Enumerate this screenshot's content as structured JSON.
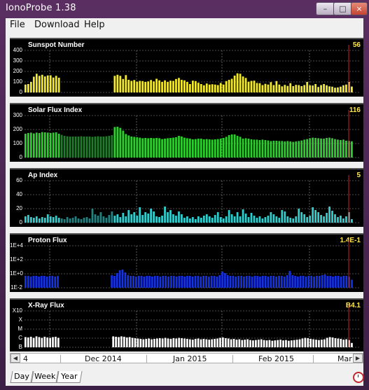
{
  "window": {
    "title": "IonoProbe 1.38"
  },
  "title_buttons": {
    "minimize": "–",
    "maximize": "□",
    "close": "×"
  },
  "menu": {
    "items": [
      "File",
      "Download",
      "Help"
    ]
  },
  "colors": {
    "sunspot": "#f4ea2d",
    "solar_flux": "#2bd12b",
    "ap": "#30cfcf",
    "proton": "#1432e6",
    "xray": "#ffffff",
    "marker": "#cc2222",
    "grid": "#9a9a9a",
    "value_text": "#ffe84a"
  },
  "chart_data": [
    {
      "type": "bar",
      "title": "Sunspot Number",
      "current_value": "56",
      "ylim": [
        0,
        400
      ],
      "yticks": [
        "400",
        "300",
        "200",
        "100",
        "0"
      ],
      "values": [
        75,
        80,
        100,
        150,
        178,
        158,
        168,
        152,
        162,
        163,
        142,
        158,
        140,
        null,
        null,
        null,
        null,
        null,
        null,
        null,
        null,
        null,
        null,
        null,
        null,
        null,
        null,
        null,
        null,
        null,
        null,
        null,
        158,
        168,
        158,
        128,
        165,
        120,
        110,
        118,
        102,
        110,
        108,
        100,
        105,
        118,
        105,
        130,
        115,
        100,
        115,
        100,
        112,
        110,
        128,
        138,
        120,
        115,
        100,
        80,
        112,
        108,
        92,
        80,
        68,
        85,
        75,
        78,
        75,
        70,
        90,
        75,
        108,
        120,
        130,
        160,
        182,
        178,
        152,
        138,
        102,
        110,
        112,
        90,
        88,
        70,
        82,
        75,
        98,
        70,
        108,
        75,
        58,
        72,
        62,
        88,
        60,
        72,
        70,
        60,
        70,
        100,
        68,
        66,
        80,
        52,
        70,
        80,
        68,
        58,
        55,
        45,
        48,
        55,
        68,
        75,
        100,
        56
      ]
    },
    {
      "type": "bar",
      "title": "Solar Flux Index",
      "current_value": "116",
      "ylim": [
        0,
        300
      ],
      "yticks": [
        "300",
        "200",
        "100",
        "0"
      ],
      "values": [
        170,
        175,
        178,
        172,
        178,
        175,
        182,
        180,
        178,
        175,
        178,
        180,
        170,
        162,
        155,
        152,
        150,
        150,
        150,
        150,
        152,
        150,
        150,
        150,
        148,
        150,
        152,
        150,
        150,
        152,
        155,
        160,
        218,
        220,
        212,
        192,
        168,
        158,
        150,
        148,
        145,
        142,
        138,
        140,
        138,
        140,
        138,
        140,
        138,
        132,
        135,
        138,
        140,
        142,
        145,
        155,
        150,
        142,
        138,
        135,
        130,
        132,
        135,
        135,
        130,
        132,
        130,
        128,
        130,
        132,
        135,
        140,
        148,
        160,
        165,
        165,
        155,
        148,
        135,
        138,
        135,
        130,
        128,
        128,
        125,
        128,
        125,
        122,
        118,
        120,
        120,
        118,
        118,
        115,
        118,
        115,
        112,
        115,
        118,
        122,
        128,
        132,
        138,
        142,
        140,
        138,
        136,
        135,
        140,
        142,
        138,
        132,
        128,
        125,
        128,
        120,
        118,
        116
      ],
      "shaded_range": [
        13,
        31
      ]
    },
    {
      "type": "bar",
      "title": "Ap Index",
      "current_value": "5",
      "ylim": [
        0,
        60
      ],
      "yticks": [
        "60",
        "40",
        "20",
        "0"
      ],
      "values": [
        9,
        11,
        8,
        7,
        9,
        6,
        8,
        7,
        12,
        9,
        8,
        10,
        7,
        6,
        5,
        8,
        6,
        7,
        9,
        6,
        5,
        7,
        8,
        6,
        20,
        12,
        10,
        15,
        9,
        7,
        11,
        16,
        10,
        12,
        8,
        14,
        9,
        18,
        12,
        15,
        10,
        22,
        11,
        15,
        13,
        20,
        16,
        9,
        8,
        10,
        23,
        15,
        18,
        12,
        10,
        16,
        12,
        7,
        9,
        6,
        8,
        5,
        9,
        7,
        10,
        12,
        9,
        7,
        11,
        15,
        8,
        6,
        9,
        18,
        12,
        9,
        15,
        9,
        19,
        13,
        8,
        14,
        10,
        7,
        9,
        6,
        8,
        10,
        15,
        12,
        9,
        7,
        18,
        16,
        9,
        7,
        6,
        9,
        20,
        15,
        12,
        8,
        10,
        22,
        18,
        15,
        11,
        9,
        14,
        23,
        17,
        12,
        8,
        10,
        6,
        9,
        15,
        5
      ],
      "shaded_range": [
        13,
        31
      ]
    },
    {
      "type": "bar",
      "title": "Proton Flux",
      "current_value": "1.4E-1",
      "yscale": "log",
      "ylim": [
        -2,
        4
      ],
      "yticks": [
        "1E+4",
        "1E+2",
        "1E+0",
        "1E-2"
      ],
      "values": [
        -0.3,
        -0.3,
        -0.4,
        -0.3,
        -0.3,
        -0.4,
        -0.3,
        -0.3,
        -0.4,
        -0.3,
        -0.3,
        -0.4,
        -0.3,
        null,
        null,
        null,
        null,
        null,
        null,
        null,
        null,
        null,
        null,
        null,
        null,
        null,
        null,
        null,
        null,
        null,
        null,
        null,
        -0.2,
        -0.3,
        0.1,
        0.5,
        0.6,
        0.2,
        -0.2,
        -0.3,
        -0.3,
        -0.4,
        -0.3,
        -0.3,
        -0.4,
        -0.3,
        -0.3,
        -0.4,
        -0.3,
        -0.3,
        -0.4,
        -0.3,
        -0.3,
        -0.4,
        -0.3,
        -0.3,
        -0.4,
        -0.3,
        -0.3,
        -0.4,
        -0.3,
        -0.3,
        -0.4,
        -0.3,
        -0.3,
        -0.4,
        -0.3,
        -0.3,
        -0.4,
        -0.3,
        -0.3,
        -0.4,
        -0.2,
        0.3,
        0.1,
        -0.2,
        -0.3,
        -0.3,
        -0.4,
        -0.3,
        -0.3,
        -0.4,
        -0.3,
        -0.3,
        -0.4,
        -0.3,
        -0.3,
        -0.4,
        -0.3,
        -0.3,
        -0.4,
        -0.3,
        -0.3,
        -0.4,
        -0.3,
        -0.3,
        -0.4,
        -0.2,
        0.4,
        -0.2,
        -0.3,
        -0.4,
        -0.3,
        -0.3,
        -0.4,
        -0.3,
        -0.3,
        -0.4,
        -0.3,
        -0.3,
        -0.2,
        -0.1,
        -0.3,
        -0.3,
        -0.4,
        -0.3,
        -0.3,
        -0.4,
        -0.3,
        -0.3,
        -0.4,
        -0.85
      ]
    },
    {
      "type": "bar",
      "title": "X-Ray Flux",
      "current_value": "B4.1",
      "yscale": "log",
      "ylim": [
        0,
        5
      ],
      "yticks": [
        "X10",
        "X",
        "M",
        "C",
        "B"
      ],
      "values": [
        1.4,
        1.35,
        1.45,
        1.3,
        1.5,
        1.4,
        1.3,
        1.45,
        1.35,
        1.3,
        1.4,
        1.45,
        1.3,
        null,
        null,
        null,
        null,
        null,
        null,
        null,
        null,
        null,
        null,
        null,
        null,
        null,
        null,
        null,
        null,
        null,
        null,
        null,
        1.5,
        1.45,
        1.4,
        1.5,
        1.45,
        1.35,
        1.4,
        1.3,
        1.25,
        1.2,
        1.15,
        1.1,
        1.15,
        1.2,
        1.1,
        1.15,
        1.2,
        1.25,
        1.2,
        1.3,
        1.2,
        1.15,
        1.25,
        1.2,
        1.3,
        1.25,
        1.2,
        1.15,
        1.1,
        1.05,
        1.15,
        1.2,
        1.1,
        1.15,
        1.1,
        1.05,
        1.1,
        1.15,
        1.2,
        1.3,
        1.35,
        1.25,
        1.2,
        1.1,
        1.15,
        1.05,
        1.1,
        1.0,
        1.05,
        1.1,
        1.0,
        0.95,
        1.0,
        1.05,
        1.1,
        1.0,
        0.95,
        1.0,
        0.9,
        0.95,
        1.0,
        1.05,
        0.95,
        1.0,
        0.9,
        0.95,
        1.0,
        1.05,
        1.1,
        1.2,
        1.3,
        1.25,
        1.15,
        1.1,
        1.05,
        1.0,
        1.05,
        1.1,
        1.3,
        1.4,
        1.35,
        1.25,
        1.2,
        1.15,
        1.05,
        1.1,
        1.0,
        0.6
      ]
    }
  ],
  "timeline": {
    "left_partial_label": "4",
    "months": [
      "Dec 2014",
      "Jan 2015",
      "Feb 2015",
      "Mar"
    ],
    "left_arrow": "◀",
    "right_arrow": "▶"
  },
  "tabs": [
    "Day",
    "Week",
    "Year"
  ],
  "active_tab": "Year"
}
